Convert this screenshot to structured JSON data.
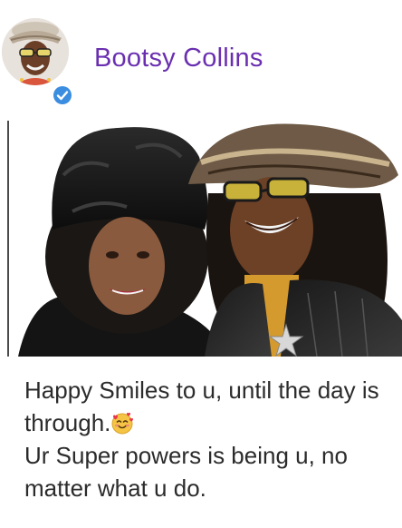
{
  "post": {
    "author_name": "Bootsy Collins",
    "verified": true,
    "caption_line1": "Happy Smiles to u, until the day is through.",
    "caption_emoji": "smiling-face-with-hearts-icon",
    "caption_line2": "Ur Super powers is being u, no matter what u do."
  },
  "colors": {
    "author_name": "#6a2fb0",
    "verified_badge": "#3b8de0",
    "caption_text": "#2b2b2b"
  }
}
